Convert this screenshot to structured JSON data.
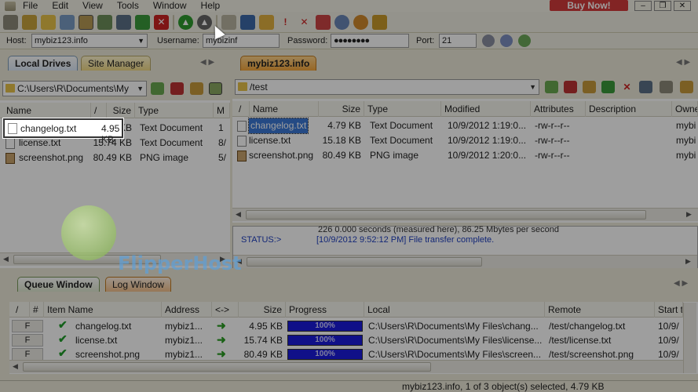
{
  "menu": [
    "File",
    "Edit",
    "View",
    "Tools",
    "Window",
    "Help"
  ],
  "buy_now": "Buy Now!",
  "window_buttons": [
    "–",
    "❐",
    "✕"
  ],
  "connection": {
    "host_label": "Host:",
    "host_value": "mybiz123.info",
    "username_label": "Username:",
    "username_value": "mybizinf",
    "password_label": "Password:",
    "password_value": "●●●●●●●●",
    "port_label": "Port:",
    "port_value": "21"
  },
  "left": {
    "tabs": [
      "Local Drives",
      "Site Manager"
    ],
    "path": "C:\\Users\\R\\Documents\\My",
    "columns": [
      "Name",
      "/",
      "Size",
      "Type",
      "M"
    ],
    "files": [
      {
        "name": "changelog.txt",
        "size": "4.95 KB",
        "type": "Text Document",
        "m": "1",
        "icon": "txt"
      },
      {
        "name": "license.txt",
        "size": "15.74 KB",
        "type": "Text Document",
        "m": "8/",
        "icon": "txt"
      },
      {
        "name": "screenshot.png",
        "size": "80.49 KB",
        "type": "PNG image",
        "m": "5/",
        "icon": "png"
      }
    ],
    "callout": {
      "name": "changelog.txt",
      "size": "4.95 KB"
    }
  },
  "right": {
    "tab": "mybiz123.info",
    "path": "/test",
    "columns": [
      "/",
      "Name",
      "Size",
      "Type",
      "Modified",
      "Attributes",
      "Description",
      "Owne"
    ],
    "files": [
      {
        "name": "changelog.txt",
        "size": "4.79 KB",
        "type": "Text Document",
        "modified": "10/9/2012 1:19:0...",
        "attributes": "-rw-r--r--",
        "owner": "mybi",
        "icon": "txt"
      },
      {
        "name": "license.txt",
        "size": "15.18 KB",
        "type": "Text Document",
        "modified": "10/9/2012 1:19:0...",
        "attributes": "-rw-r--r--",
        "owner": "mybi",
        "icon": "txt"
      },
      {
        "name": "screenshot.png",
        "size": "80.49 KB",
        "type": "PNG image",
        "modified": "10/9/2012 1:20:0...",
        "attributes": "-rw-r--r--",
        "owner": "mybi",
        "icon": "png"
      }
    ]
  },
  "log": {
    "line1": "226 0.000 seconds (measured here), 86.25 Mbytes per second",
    "status_label": "STATUS:>",
    "status_msg": "[10/9/2012 9:52:12 PM] File transfer complete."
  },
  "queue": {
    "tabs": [
      "Queue Window",
      "Log Window"
    ],
    "columns": [
      "/",
      "#",
      "Item Name",
      "Address",
      "<->",
      "Size",
      "Progress",
      "Local",
      "Remote",
      "Start t"
    ],
    "rows": [
      {
        "flag": "F",
        "name": "changelog.txt",
        "address": "mybiz1...",
        "size": "4.95 KB",
        "progress": "100%",
        "progress_value": 1.0,
        "local": "C:\\Users\\R\\Documents\\My Files\\chang...",
        "remote": "/test/changelog.txt",
        "start": "10/9/"
      },
      {
        "flag": "F",
        "name": "license.txt",
        "address": "mybiz1...",
        "size": "15.74 KB",
        "progress": "100%",
        "progress_value": 1.0,
        "local": "C:\\Users\\R\\Documents\\My Files\\license...",
        "remote": "/test/license.txt",
        "start": "10/9/"
      },
      {
        "flag": "F",
        "name": "screenshot.png",
        "address": "mybiz1...",
        "size": "80.49 KB",
        "progress": "100%",
        "progress_value": 1.0,
        "local": "C:\\Users\\R\\Documents\\My Files\\screen...",
        "remote": "/test/screenshot.png",
        "start": "10/9/"
      }
    ]
  },
  "status_bar": "mybiz123.info, 1 of 3 object(s) selected, 4.79 KB",
  "watermark": {
    "text": "FlipperHost"
  },
  "colors": {
    "progress": "#1a1adc",
    "accent_tab": "#f4a63c",
    "selection": "#3a78d6",
    "buy_now": "#d23a3a"
  }
}
